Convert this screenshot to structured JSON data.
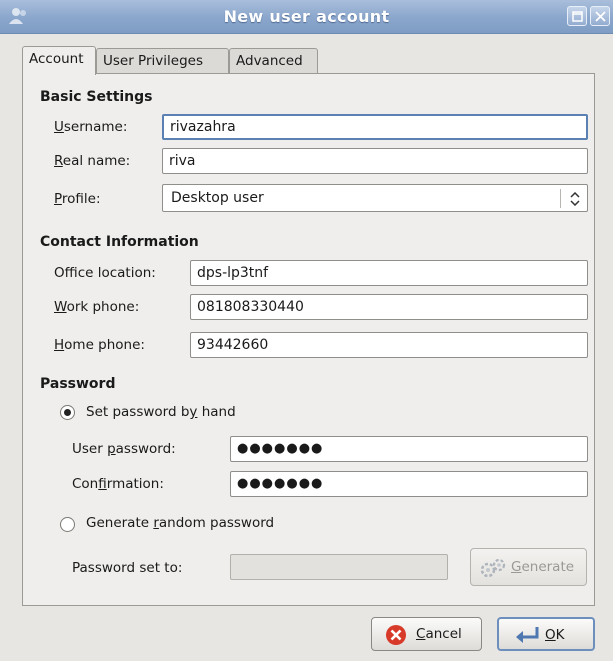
{
  "window": {
    "title": "New user account",
    "app_icon": "users-icon"
  },
  "tabs": [
    {
      "label": "Account",
      "active": true
    },
    {
      "label": "User Privileges",
      "active": false
    },
    {
      "label": "Advanced",
      "active": false
    }
  ],
  "basic_settings": {
    "title": "Basic Settings",
    "username": {
      "label_u": "U",
      "label_rest": "sername:",
      "value": "rivazahra"
    },
    "real_name": {
      "label_u": "R",
      "label_rest": "eal name:",
      "value": "riva"
    },
    "profile": {
      "label_u": "P",
      "label_rest": "rofile:",
      "value": "Desktop user"
    }
  },
  "contact_information": {
    "title": "Contact Information",
    "office_location": {
      "label_pre": "Off",
      "label_u": "i",
      "label_rest": "ce location:",
      "value": "dps-lp3tnf"
    },
    "work_phone": {
      "label_u": "W",
      "label_rest": "ork phone:",
      "value": "081808330440"
    },
    "home_phone": {
      "label_u": "H",
      "label_rest": "ome phone:",
      "value": "93442660"
    }
  },
  "password": {
    "title": "Password",
    "set_by_hand": {
      "label_pre": "Set password b",
      "label_u": "y",
      "label_rest": " hand",
      "selected": true
    },
    "user_password": {
      "label_pre": "User ",
      "label_u": "p",
      "label_rest": "assword:",
      "value": "●●●●●●●"
    },
    "confirmation": {
      "label_pre": "Con",
      "label_u": "f",
      "label_rest": "irmation:",
      "value": "●●●●●●●"
    },
    "generate_random": {
      "label_pre": "Generate ",
      "label_u": "r",
      "label_rest": "andom password",
      "selected": false
    },
    "password_set_to": {
      "label": "Password set to:",
      "value": ""
    },
    "generate_button": {
      "label_u": "G",
      "label_rest": "enerate",
      "enabled": false
    }
  },
  "buttons": {
    "cancel": {
      "label_u": "C",
      "label_rest": "ancel"
    },
    "ok": {
      "label_u": "O",
      "label_rest": "K"
    }
  },
  "colors": {
    "titlebar": "#8aa6cc",
    "focus_border": "#5b80b2",
    "cancel_icon": "#d83a2a"
  }
}
